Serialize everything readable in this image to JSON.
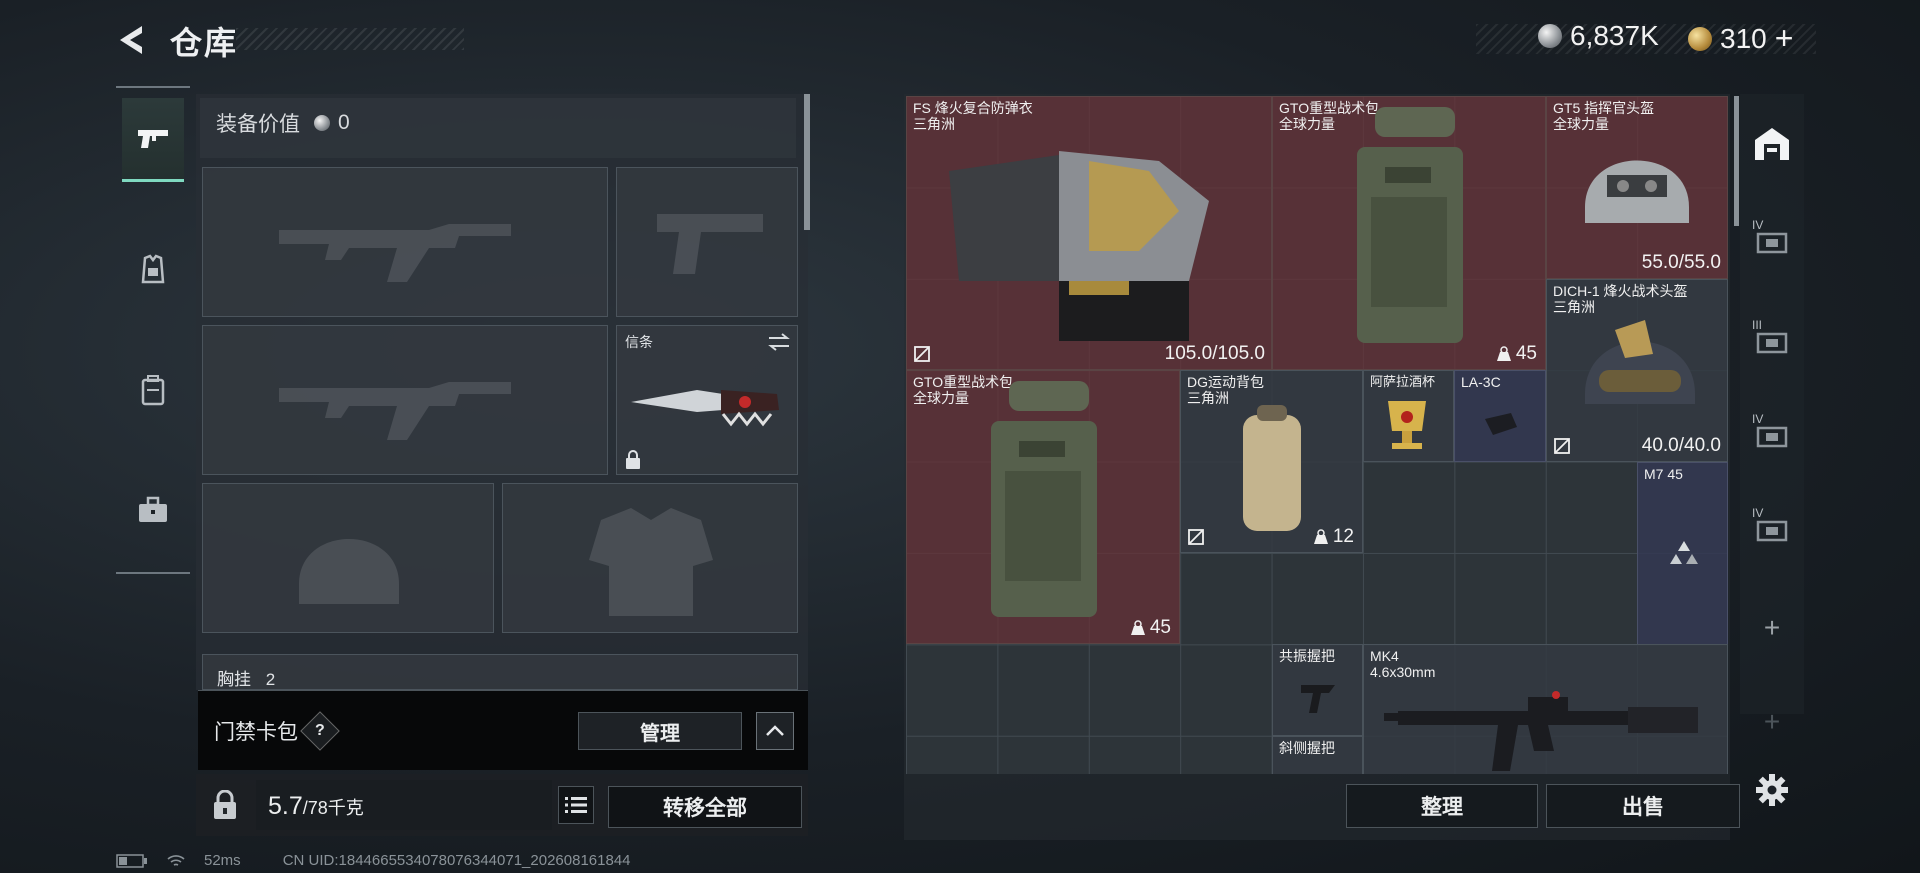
{
  "header": {
    "title": "仓库"
  },
  "currency": {
    "silver": "6,837K",
    "gold": "310",
    "gold_plus": "+"
  },
  "loadout": {
    "value_label": "装备价值",
    "value": "0",
    "token_label": "信条",
    "chest_rig_label": "胸挂",
    "chest_rig_count": "2"
  },
  "card_pack": {
    "label": "门禁卡包",
    "help": "?",
    "manage": "管理"
  },
  "weight": {
    "current": "5.7",
    "max": "/78千克"
  },
  "actions": {
    "transfer_all": "转移全部",
    "sort": "整理",
    "sell": "出售"
  },
  "storage": {
    "items": [
      {
        "name": "FS 烽火复合防弹衣\n三角洲",
        "durability": "105.0/105.0"
      },
      {
        "name": "GTO重型战术包\n全球力量",
        "capacity": "45"
      },
      {
        "name": "GT5 指挥官头盔\n全球力量",
        "durability": "55.0/55.0"
      },
      {
        "name": "DICH-1 烽火战术头盔\n三角洲",
        "durability": "40.0/40.0"
      },
      {
        "name": "GTO重型战术包\n全球力量",
        "capacity": "45"
      },
      {
        "name": "DG运动背包\n三角洲",
        "capacity": "12"
      },
      {
        "name": "阿萨拉酒杯"
      },
      {
        "name": "LA-3C"
      },
      {
        "name": "M7 45"
      },
      {
        "name": "共振握把"
      },
      {
        "name": "斜侧握把"
      },
      {
        "name": "MK4\n4.6x30mm"
      }
    ]
  },
  "right_rail": {
    "tiers": [
      "IV",
      "III",
      "IV",
      "IV"
    ],
    "add": "+"
  },
  "footer": {
    "ping": "52ms",
    "uid": "CN UID:18446655340780763440​71_202608161844"
  },
  "colors": {
    "accent": "#7fd9c0",
    "item_red": "#6c3036",
    "item_navy": "#343852"
  }
}
